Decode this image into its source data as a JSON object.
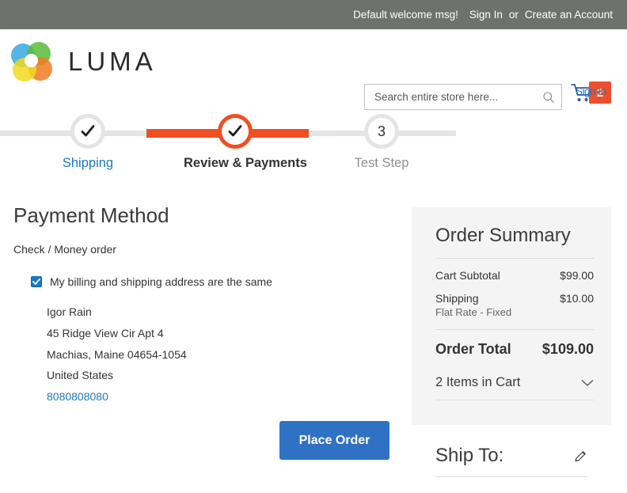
{
  "top_panel": {
    "welcome_message": "Default welcome msg!",
    "sign_in_label": "Sign In",
    "or_label": "or",
    "create_account_label": "Create an Account"
  },
  "header": {
    "logo_text": "LUMA",
    "logo_icon": "luma-circles-logo",
    "search": {
      "placeholder": "Search entire store here...",
      "value": "",
      "icon": "search-icon"
    },
    "cart": {
      "icon": "shopping-cart-icon",
      "badge_count": "2",
      "overlay_text": "Sign In"
    }
  },
  "progress": {
    "steps": [
      {
        "label": "Shipping",
        "state": "complete",
        "marker": "check-icon"
      },
      {
        "label": "Review & Payments",
        "state": "active",
        "marker": "check-icon"
      },
      {
        "label": "Test Step",
        "state": "upcoming",
        "marker": "3"
      }
    ]
  },
  "main": {
    "page_title": "Payment Method",
    "payment_method_name": "Check / Money order",
    "billing_same_label": "My billing and shipping address are the same",
    "billing_same_checked": true,
    "address": {
      "name": "Igor Rain",
      "street": "45 Ridge View Cir Apt 4",
      "city_region_zip": "Machias, Maine 04654-1054",
      "country": "United States",
      "phone": "8080808080"
    },
    "place_order_label": "Place Order"
  },
  "order_summary": {
    "title": "Order Summary",
    "rows": [
      {
        "label": "Cart Subtotal",
        "value": "$99.00",
        "sub": ""
      },
      {
        "label": "Shipping",
        "value": "$10.00",
        "sub": "Flat Rate - Fixed"
      }
    ],
    "total_label": "Order Total",
    "total_value": "$109.00",
    "items_label": "2 Items in Cart",
    "items_chevron_icon": "chevron-down-icon"
  },
  "ship_to": {
    "title": "Ship To:",
    "edit_icon": "pencil-icon"
  },
  "colors": {
    "top_panel_bg": "#6e716c",
    "accent_orange": "#f04e23",
    "link_blue": "#1979c3",
    "button_blue": "#2f72c4",
    "badge_red": "#ed4f2e",
    "panel_gray": "#f4f4f4"
  }
}
